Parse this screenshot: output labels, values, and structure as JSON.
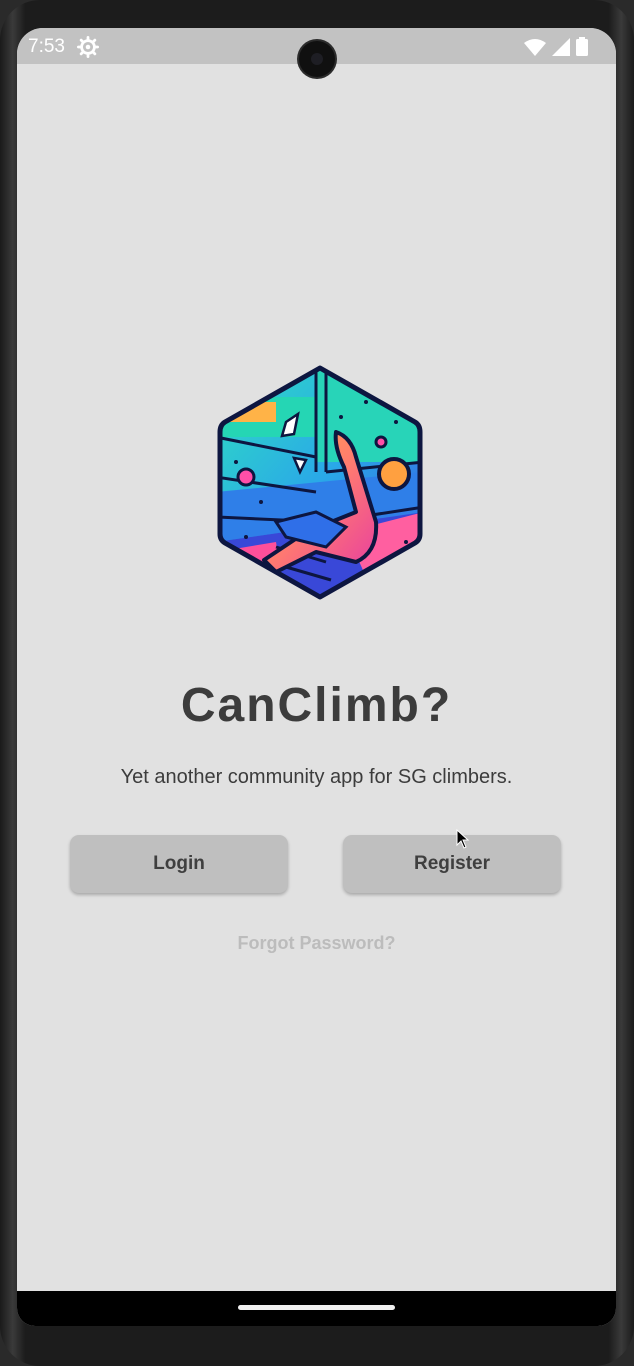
{
  "status_bar": {
    "time": "7:53",
    "icons": [
      "gear-icon",
      "wifi-icon",
      "signal-icon",
      "battery-icon"
    ]
  },
  "app": {
    "name": "CanClimb?",
    "tagline": "Yet another community app for SG climbers.",
    "logo_icon": "climber-hexagon-logo"
  },
  "actions": {
    "login_label": "Login",
    "register_label": "Register",
    "forgot_password_label": "Forgot Password?"
  },
  "colors": {
    "background": "#e1e1e1",
    "button": "#bfbfbf",
    "text": "#3c3c3c",
    "muted_link": "#bcbcbc"
  }
}
